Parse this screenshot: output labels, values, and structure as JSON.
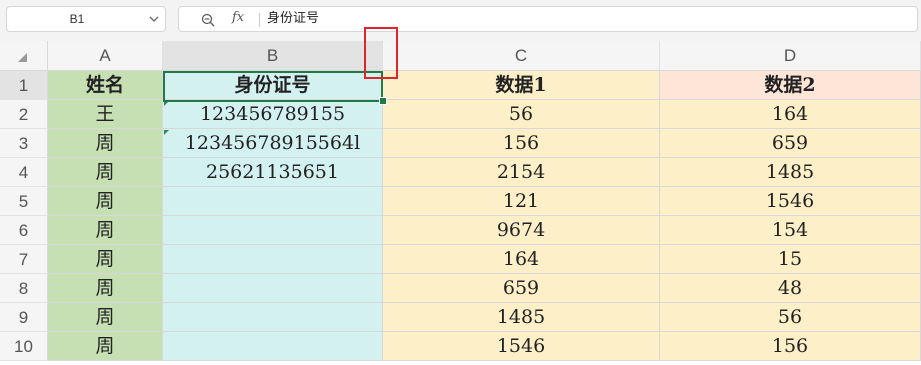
{
  "name_box": {
    "value": "B1",
    "chevron_icon": "chevron-down-icon"
  },
  "formula_bar": {
    "zoom_icon": "zoom-out-icon",
    "fx_label": "fx",
    "content": "身份证号"
  },
  "columns": [
    "A",
    "B",
    "C",
    "D"
  ],
  "rows": [
    "1",
    "2",
    "3",
    "4",
    "5",
    "6",
    "7",
    "8",
    "9",
    "10"
  ],
  "table": {
    "headers": [
      "姓名",
      "身份证号",
      "数据1",
      "数据2"
    ],
    "data": [
      [
        "王",
        "123456789155",
        "56",
        "164"
      ],
      [
        "周",
        "12345678915564l",
        "156",
        "659"
      ],
      [
        "周",
        "25621135651",
        "2154",
        "1485"
      ],
      [
        "周",
        "",
        "121",
        "1546"
      ],
      [
        "周",
        "",
        "9674",
        "154"
      ],
      [
        "周",
        "",
        "164",
        "15"
      ],
      [
        "周",
        "",
        "659",
        "48"
      ],
      [
        "周",
        "",
        "1485",
        "56"
      ],
      [
        "周",
        "",
        "1546",
        "156"
      ]
    ]
  },
  "colors": {
    "col_a_fill": "#c6e0b4",
    "col_b_fill": "#d3f1ef",
    "col_c_fill": "#fdefc8",
    "d_header_fill": "#fde6d8",
    "selection": "#21794a",
    "annotation": "#e0242b"
  }
}
